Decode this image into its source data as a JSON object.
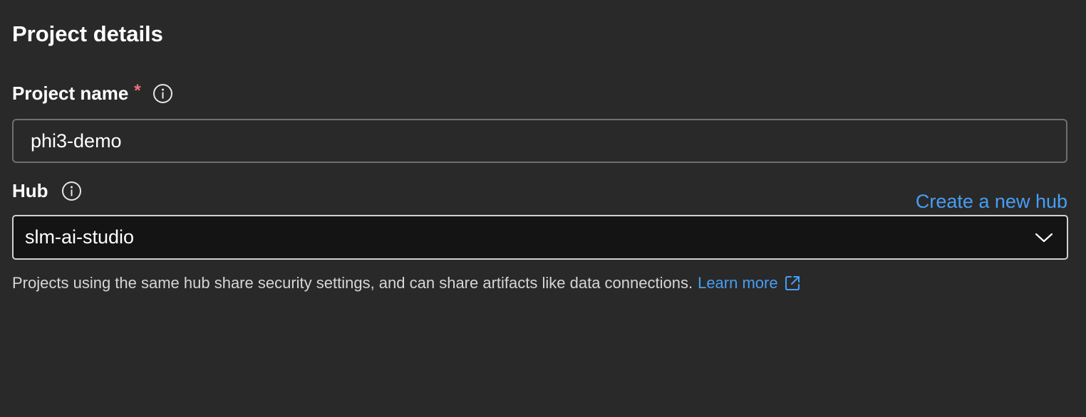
{
  "section": {
    "title": "Project details"
  },
  "project_name": {
    "label": "Project name",
    "required_marker": "*",
    "value": "phi3-demo",
    "info_icon": "info-icon"
  },
  "hub": {
    "label": "Hub",
    "info_icon": "info-icon",
    "create_link": "Create a new hub",
    "selected": "slm-ai-studio",
    "dropdown_icon": "chevron-down-icon"
  },
  "helper": {
    "text": "Projects using the same hub share security settings, and can share artifacts like data connections.",
    "learn_more": "Learn more",
    "link_icon": "external-link-icon"
  },
  "colors": {
    "background": "#292929",
    "accent_link": "#479ef5",
    "required": "#f1707b",
    "select_background": "#141414"
  }
}
